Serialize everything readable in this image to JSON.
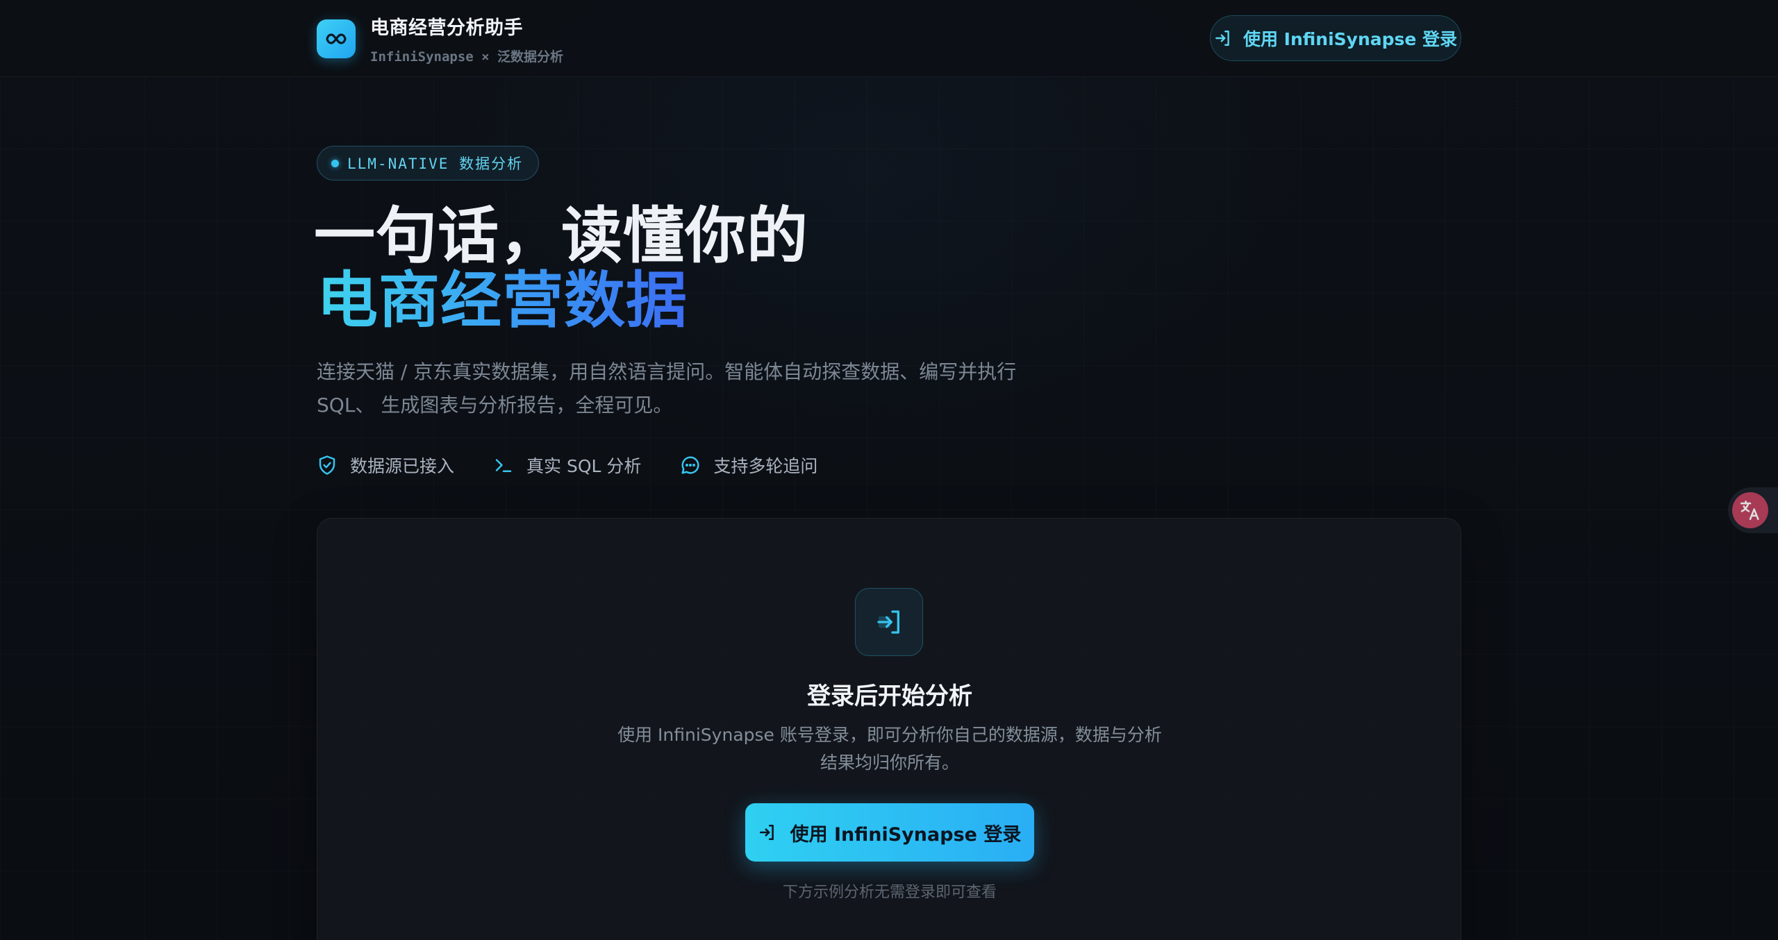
{
  "header": {
    "app_title": "电商经营分析助手",
    "subtitle": "InfiniSynapse × 泛数据分析",
    "logo_icon": "infinity-icon",
    "login_label": "使用 InfiniSynapse 登录"
  },
  "hero": {
    "badge": "LLM-NATIVE 数据分析",
    "title_line1": "一句话，读懂你的",
    "title_line2": "电商经营数据",
    "description": "连接天猫 / 京东真实数据集，用自然语言提问。智能体自动探查数据、编写并执行 SQL、 生成图表与分析报告，全程可见。",
    "features": [
      {
        "icon": "shield-check-icon",
        "label": "数据源已接入"
      },
      {
        "icon": "terminal-icon",
        "label": "真实 SQL 分析"
      },
      {
        "icon": "chat-bubble-icon",
        "label": "支持多轮追问"
      }
    ]
  },
  "login_card": {
    "icon": "login-icon",
    "title": "登录后开始分析",
    "description": "使用 InfiniSynapse 账号登录，即可分析你自己的数据源，数据与分析结果均归你所有。",
    "button_label": "使用 InfiniSynapse 登录",
    "hint": "下方示例分析无需登录即可查看"
  },
  "widgets": {
    "translate_icon": "translate-icon"
  },
  "colors": {
    "accent": "#36c4ee",
    "accent_blue": "#3b6cf3",
    "background": "#0b0e13"
  }
}
